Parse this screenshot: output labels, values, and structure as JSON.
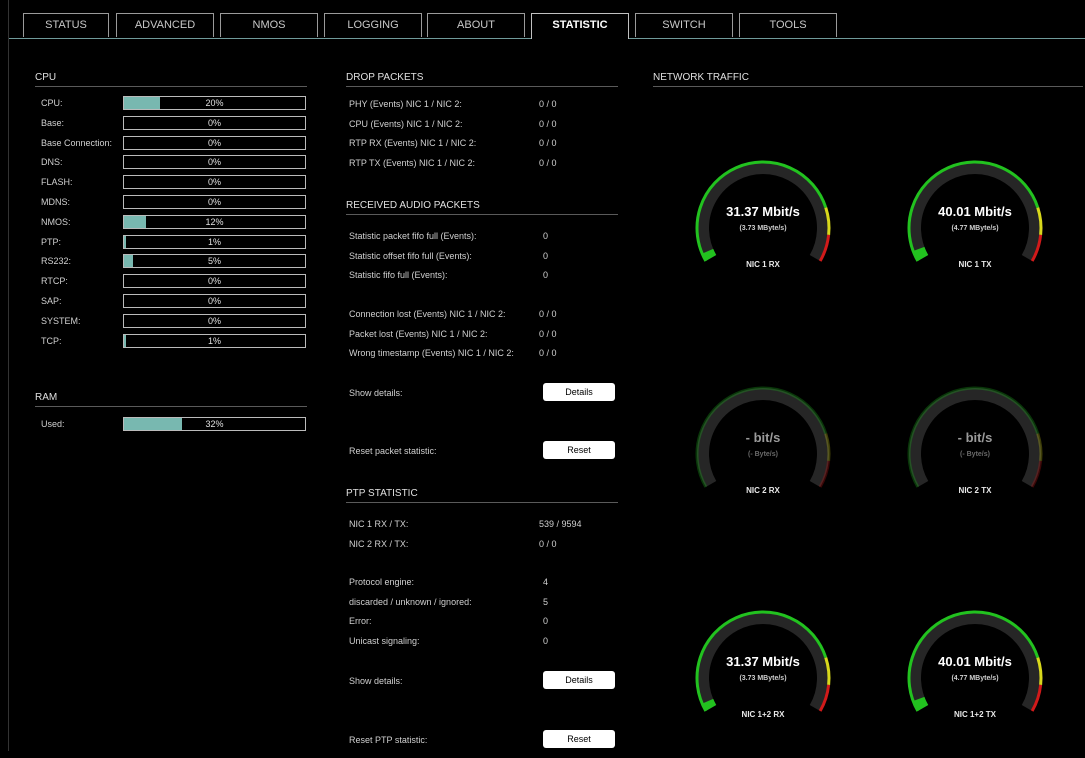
{
  "tabs": [
    "STATUS",
    "ADVANCED",
    "NMOS",
    "LOGGING",
    "ABOUT",
    "STATISTIC",
    "SWITCH",
    "TOOLS"
  ],
  "active_tab": "STATISTIC",
  "cpu": {
    "title": "CPU",
    "rows": [
      {
        "label": "CPU:",
        "value": "20%",
        "level": 0.2
      },
      {
        "label": "Base:",
        "value": "0%",
        "level": 0
      },
      {
        "label": "Base Connection:",
        "value": "0%",
        "level": 0
      },
      {
        "label": "DNS:",
        "value": "0%",
        "level": 0
      },
      {
        "label": "FLASH:",
        "value": "0%",
        "level": 0
      },
      {
        "label": "MDNS:",
        "value": "0%",
        "level": 0
      },
      {
        "label": "NMOS:",
        "value": "12%",
        "level": 0.12
      },
      {
        "label": "PTP:",
        "value": "1%",
        "level": 0.01
      },
      {
        "label": "RS232:",
        "value": "5%",
        "level": 0.05
      },
      {
        "label": "RTCP:",
        "value": "0%",
        "level": 0
      },
      {
        "label": "SAP:",
        "value": "0%",
        "level": 0
      },
      {
        "label": "SYSTEM:",
        "value": "0%",
        "level": 0
      },
      {
        "label": "TCP:",
        "value": "1%",
        "level": 0.01
      }
    ]
  },
  "ram": {
    "title": "RAM",
    "rows": [
      {
        "label": "Used:",
        "value": "32%",
        "level": 0.32
      }
    ]
  },
  "drop_packets": {
    "title": "DROP PACKETS",
    "rows": [
      {
        "label": "PHY (Events) NIC 1 / NIC 2:",
        "value": "0 / 0"
      },
      {
        "label": "CPU (Events) NIC 1 / NIC 2:",
        "value": "0 / 0"
      },
      {
        "label": "RTP RX (Events) NIC 1 / NIC 2:",
        "value": "0 / 0"
      },
      {
        "label": "RTP TX (Events) NIC 1 / NIC 2:",
        "value": "0 / 0"
      }
    ]
  },
  "received_audio": {
    "title": "RECEIVED AUDIO PACKETS",
    "rows_a": [
      {
        "label": "Statistic packet fifo full (Events):",
        "value": "0"
      },
      {
        "label": "Statistic offset fifo full (Events):",
        "value": "0"
      },
      {
        "label": "Statistic fifo full (Events):",
        "value": "0"
      }
    ],
    "rows_b": [
      {
        "label": "Connection lost (Events) NIC 1 / NIC 2:",
        "value": "0 / 0"
      },
      {
        "label": "Packet lost (Events) NIC 1 / NIC 2:",
        "value": "0 / 0"
      },
      {
        "label": "Wrong timestamp (Events) NIC 1 / NIC 2:",
        "value": "0 / 0"
      }
    ],
    "show_details_label": "Show details:",
    "details_button": "Details",
    "reset_label": "Reset packet statistic:",
    "reset_button": "Reset"
  },
  "ptp": {
    "title": "PTP STATISTIC",
    "rows_a": [
      {
        "label": "NIC 1 RX / TX:",
        "value": "539 / 9594"
      },
      {
        "label": "NIC 2 RX / TX:",
        "value": "0 / 0"
      }
    ],
    "rows_b": [
      {
        "label": "Protocol engine:",
        "value": "4"
      },
      {
        "label": "discarded / unknown / ignored:",
        "value": "5"
      },
      {
        "label": "Error:",
        "value": "0"
      },
      {
        "label": "Unicast signaling:",
        "value": "0"
      }
    ],
    "show_details_label": "Show details:",
    "details_button": "Details",
    "reset_label": "Reset PTP statistic:",
    "reset_button": "Reset"
  },
  "network": {
    "title": "NETWORK TRAFFIC",
    "gauges": [
      {
        "name": "NIC 1 RX",
        "rate": "31.37 Mbit/s",
        "bytes": "(3.73 MByte/s)",
        "level": 0.03,
        "active": true
      },
      {
        "name": "NIC 1 TX",
        "rate": "40.01 Mbit/s",
        "bytes": "(4.77 MByte/s)",
        "level": 0.04,
        "active": true
      },
      {
        "name": "NIC 2 RX",
        "rate": "- bit/s",
        "bytes": "(- Byte/s)",
        "level": 0,
        "active": false
      },
      {
        "name": "NIC 2 TX",
        "rate": "- bit/s",
        "bytes": "(- Byte/s)",
        "level": 0,
        "active": false
      },
      {
        "name": "NIC 1+2 RX",
        "rate": "31.37 Mbit/s",
        "bytes": "(3.73 MByte/s)",
        "level": 0.03,
        "active": true
      },
      {
        "name": "NIC 1+2 TX",
        "rate": "40.01 Mbit/s",
        "bytes": "(4.77 MByte/s)",
        "level": 0.04,
        "active": true
      }
    ]
  },
  "colors": {
    "accent": "#78b8b0",
    "gauge_green": "#22c21f",
    "gauge_yellow": "#d8d81c",
    "gauge_red": "#d11a1a",
    "gauge_track": "#262626"
  }
}
